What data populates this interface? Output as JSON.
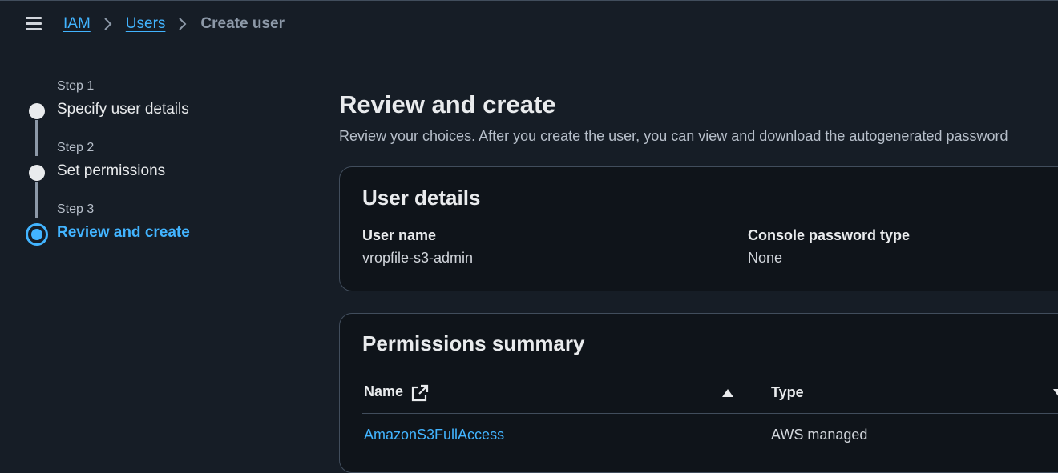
{
  "breadcrumb": {
    "items": [
      {
        "label": "IAM"
      },
      {
        "label": "Users"
      },
      {
        "label": "Create user"
      }
    ]
  },
  "stepper": {
    "steps": [
      {
        "number": "Step 1",
        "title": "Specify user details"
      },
      {
        "number": "Step 2",
        "title": "Set permissions"
      },
      {
        "number": "Step 3",
        "title": "Review and create"
      }
    ],
    "active_step": 3
  },
  "main": {
    "title": "Review and create",
    "description": "Review your choices. After you create the user, you can view and download the autogenerated password"
  },
  "user_details": {
    "title": "User details",
    "user_name_label": "User name",
    "user_name_value": "vropfile-s3-admin",
    "password_type_label": "Console password type",
    "password_type_value": "None"
  },
  "permissions_summary": {
    "title": "Permissions summary",
    "columns": [
      "Name",
      "Type"
    ],
    "rows": [
      {
        "name": "AmazonS3FullAccess",
        "type": "AWS managed"
      }
    ]
  },
  "icons": {
    "menu": "hamburger-menu-icon",
    "separator": "chevron-right-icon",
    "external": "external-link-icon",
    "sort_asc": "sort-ascending-icon",
    "sort": "sort-descending-icon"
  },
  "colors": {
    "background": "#161d26",
    "panel": "#0f141a",
    "accent": "#42b4ff",
    "border": "#414d5c"
  }
}
